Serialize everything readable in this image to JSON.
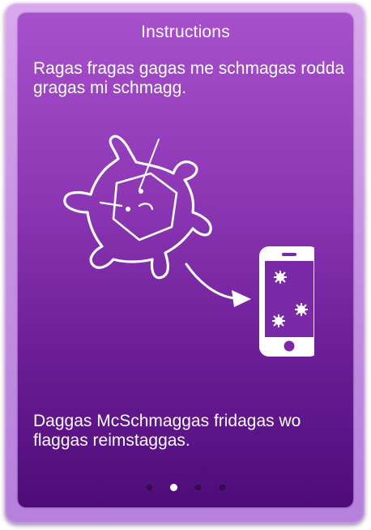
{
  "dialog": {
    "title": "Instructions",
    "top_text": "Ragas fragas gagas me schmagas rodda gragas mi schmagg.",
    "bottom_text": "Daggas McSchmaggas fridagas wo flaggas reimstaggas."
  },
  "illustration": {
    "virus": "virus-icon",
    "arrow": "curved-arrow-icon",
    "phone": "smartphone-icon",
    "mini_viruses": "mini-virus-icon"
  },
  "pager": {
    "count": 4,
    "active_index": 1
  },
  "colors": {
    "card_top": "#a850cc",
    "card_bottom": "#4e0c78",
    "frame": "#c893e4",
    "text": "#ffffff",
    "dot_inactive": "#3a0a52",
    "dot_active": "#ffffff"
  }
}
